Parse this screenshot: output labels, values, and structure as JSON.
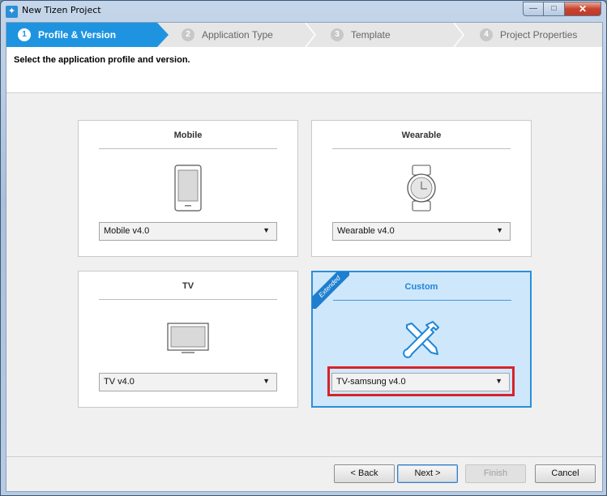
{
  "window": {
    "title": "New Tizen Project",
    "app_icon": "tizen-logo-icon"
  },
  "window_controls": {
    "minimize": "—",
    "maximize": "□",
    "close": "✕"
  },
  "wizard_steps": [
    {
      "num": "1",
      "label": "Profile & Version",
      "active": true
    },
    {
      "num": "2",
      "label": "Application Type",
      "active": false
    },
    {
      "num": "3",
      "label": "Template",
      "active": false
    },
    {
      "num": "4",
      "label": "Project Properties",
      "active": false
    }
  ],
  "subtitle": "Select the application profile and version.",
  "profiles": {
    "mobile": {
      "title": "Mobile",
      "icon": "phone-icon",
      "version": "Mobile  v4.0"
    },
    "wearable": {
      "title": "Wearable",
      "icon": "watch-icon",
      "version": "Wearable  v4.0"
    },
    "tv": {
      "title": "TV",
      "icon": "tv-icon",
      "version": "TV  v4.0"
    },
    "custom": {
      "title": "Custom",
      "icon": "tools-icon",
      "version": "TV-samsung  v4.0",
      "ribbon": "Extended",
      "selected": true
    }
  },
  "buttons": {
    "back": "< Back",
    "next": "Next >",
    "finish": "Finish",
    "cancel": "Cancel"
  },
  "colors": {
    "accent": "#1e94e0",
    "selected_bg": "#cfe7fb",
    "highlight": "#d8232a"
  }
}
